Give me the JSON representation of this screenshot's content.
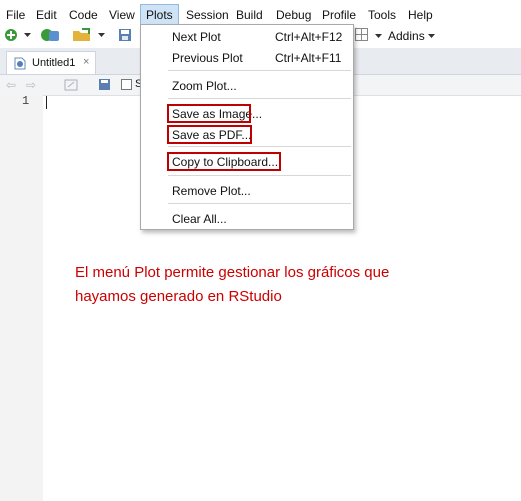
{
  "menubar": {
    "items": [
      {
        "label": "File"
      },
      {
        "label": "Edit"
      },
      {
        "label": "Code"
      },
      {
        "label": "View"
      },
      {
        "label": "Plots",
        "active": true
      },
      {
        "label": "Session"
      },
      {
        "label": "Build"
      },
      {
        "label": "Debug"
      },
      {
        "label": "Profile"
      },
      {
        "label": "Tools"
      },
      {
        "label": "Help"
      }
    ]
  },
  "toolbar": {
    "addins_label": "Addins",
    "icons": [
      "new-file-icon",
      "dropdown-arrow-icon",
      "new-project-icon",
      "open-folder-icon",
      "save-icon",
      "grid-icon"
    ]
  },
  "editor": {
    "tab_label": "Untitled1",
    "source_checkbox_label": "S",
    "line_numbers": [
      "1"
    ]
  },
  "plots_menu": {
    "items": [
      {
        "label": "Next Plot",
        "shortcut": "Ctrl+Alt+F12"
      },
      {
        "label": "Previous Plot",
        "shortcut": "Ctrl+Alt+F11"
      },
      {
        "label": "Zoom Plot..."
      },
      {
        "label": "Save as Image...",
        "highlighted": true
      },
      {
        "label": "Save as PDF...",
        "highlighted": true
      },
      {
        "label": "Copy to Clipboard...",
        "highlighted": true
      },
      {
        "label": "Remove Plot..."
      },
      {
        "label": "Clear All..."
      }
    ]
  },
  "annotation": {
    "line1": "El menú Plot permite gestionar los gráficos que",
    "line2": "hayamos generado en RStudio"
  },
  "colors": {
    "menu_active_bg": "#cfe3f7",
    "highlight_border": "#c00000",
    "annotation_text": "#cc0000",
    "tabbar_bg": "#e8ecf1"
  }
}
